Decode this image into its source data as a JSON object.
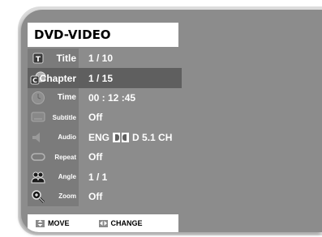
{
  "menu_title": "DVD-VIDEO",
  "items": [
    {
      "label": "Title",
      "value": "1 / 10",
      "icon": "title-t-icon"
    },
    {
      "label": "Chapter",
      "value": "1 / 15",
      "icon": "chapter-c-icon",
      "selected": true
    },
    {
      "label": "Time",
      "value": "00 : 12 :45",
      "icon": "clock-icon"
    },
    {
      "label": "Subtitle",
      "value": "Off",
      "icon": "subtitle-icon"
    },
    {
      "label": "Audio",
      "value_lang": "ENG",
      "value_rest": "D 5.1 CH",
      "icon": "speaker-icon"
    },
    {
      "label": "Repeat",
      "value": "Off",
      "icon": "repeat-icon"
    },
    {
      "label": "Angle",
      "value": "1 / 1",
      "icon": "angle-icon"
    },
    {
      "label": "Zoom",
      "value": "Off",
      "icon": "zoom-icon"
    }
  ],
  "footer": {
    "move_label": "MOVE",
    "change_label": "CHANGE"
  },
  "colors": {
    "panel": "#8c8c8c",
    "label_column": "#7b7b7b",
    "selected_row": "#5f5f5f",
    "text": "#ffffff"
  }
}
